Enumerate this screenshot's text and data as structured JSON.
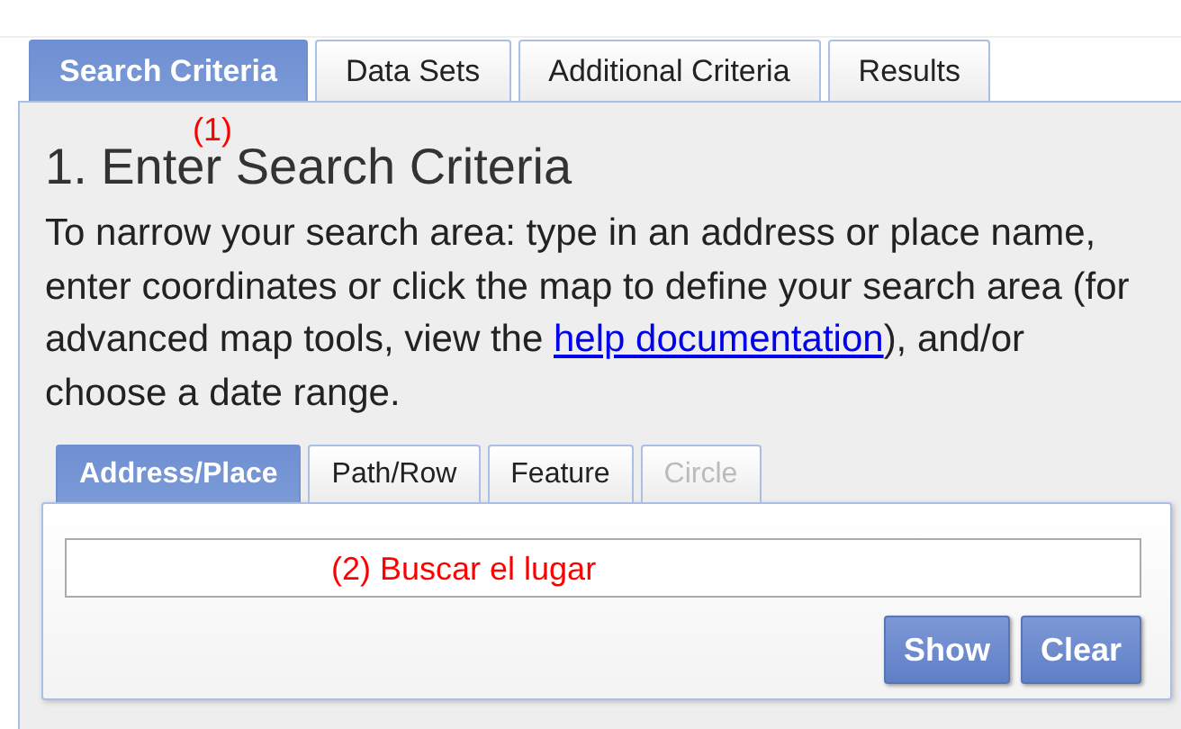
{
  "tabs": [
    {
      "label": "Search Criteria",
      "selected": true
    },
    {
      "label": "Data Sets",
      "selected": false
    },
    {
      "label": "Additional Criteria",
      "selected": false
    },
    {
      "label": "Results",
      "selected": false
    }
  ],
  "annotations": [
    {
      "text": "(1)"
    },
    {
      "text": "(2) Buscar el lugar"
    }
  ],
  "heading": "1. Enter Search Criteria",
  "intro": {
    "before": "To narrow your search area: type in an address or place name, enter coordinates or click the map to define your search area (for advanced map tools, view the ",
    "link": "help documentation",
    "after": "), and/or choose a date range."
  },
  "subtabs": [
    {
      "label": "Address/Place",
      "selected": true,
      "disabled": false
    },
    {
      "label": "Path/Row",
      "selected": false,
      "disabled": false
    },
    {
      "label": "Feature",
      "selected": false,
      "disabled": false
    },
    {
      "label": "Circle",
      "selected": false,
      "disabled": true
    }
  ],
  "buttons": [
    "Show",
    "Clear"
  ]
}
